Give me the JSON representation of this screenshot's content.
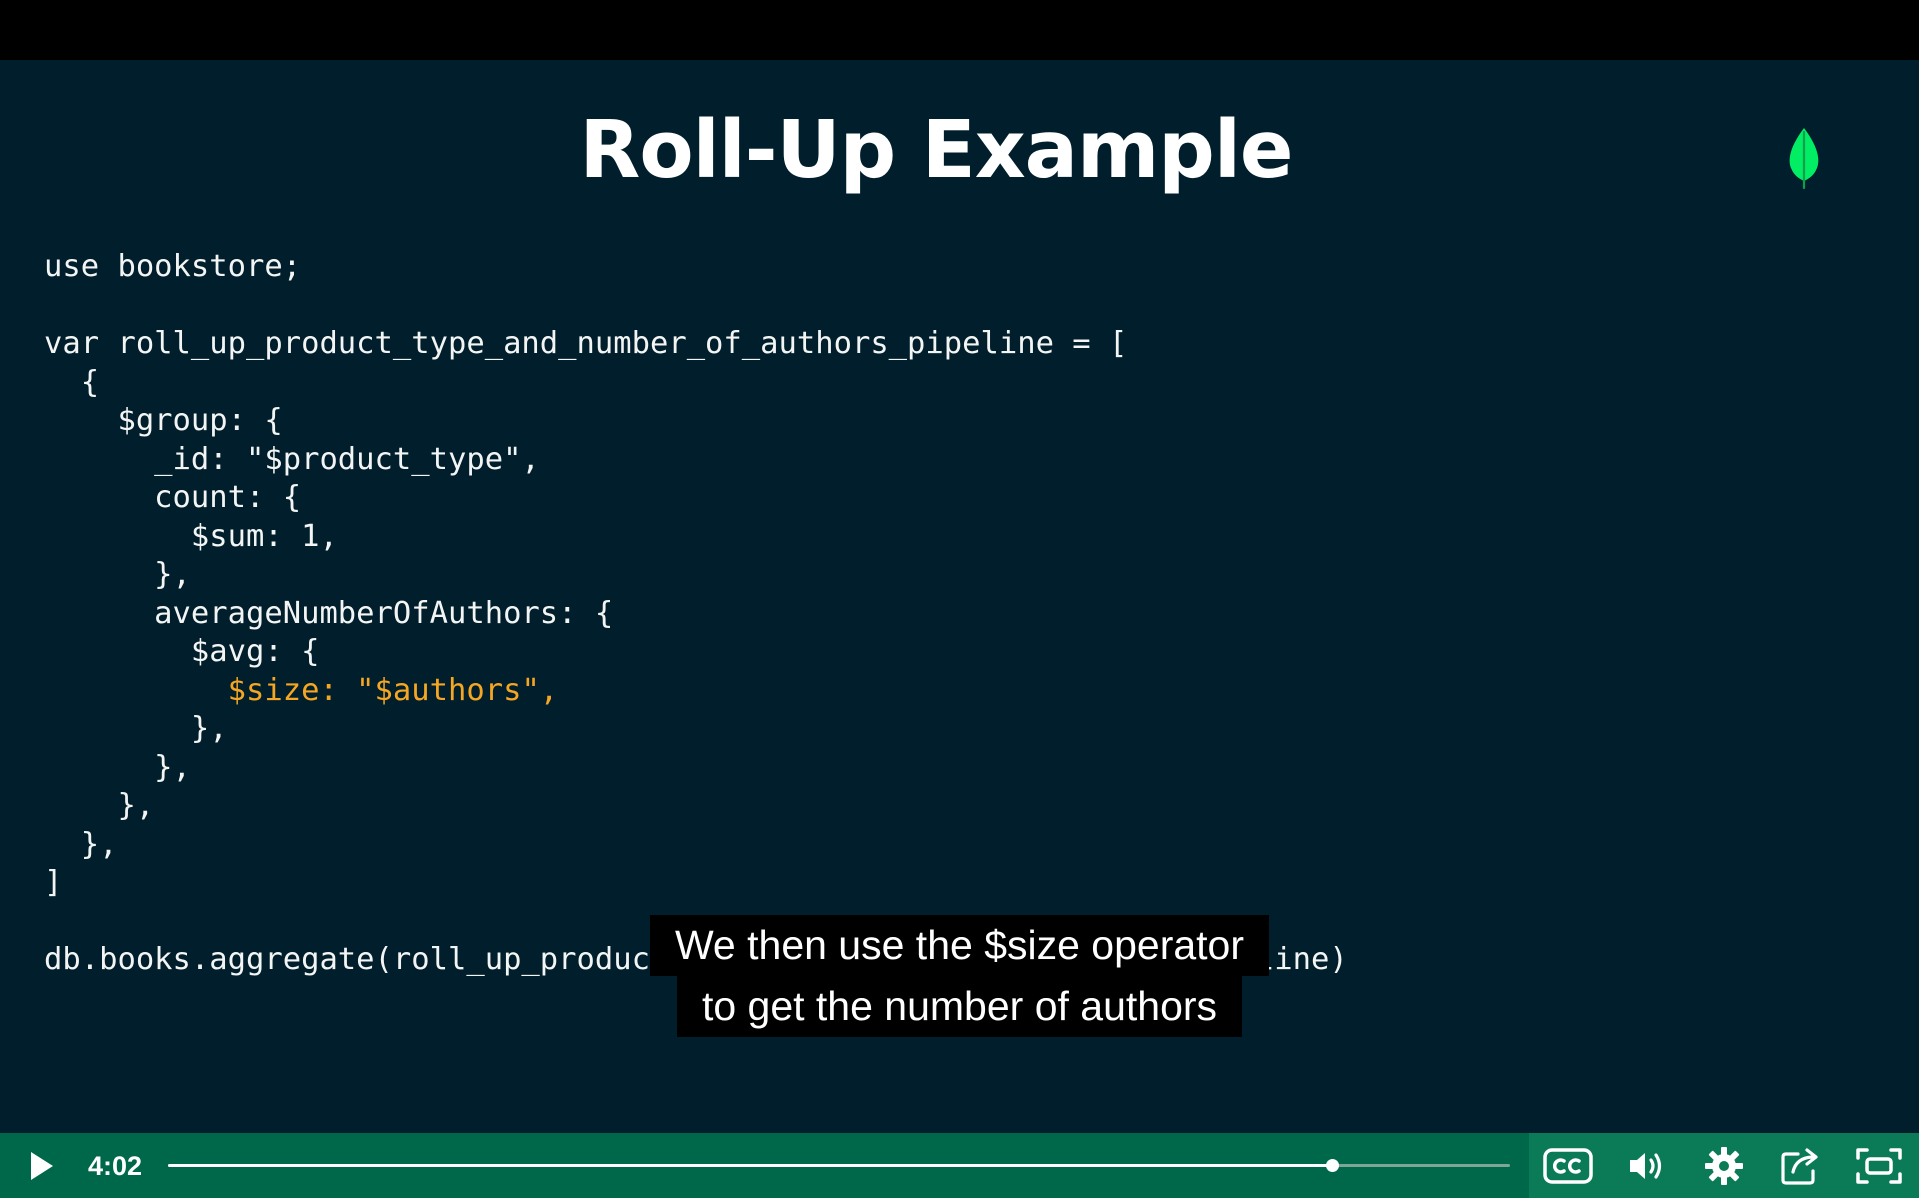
{
  "slide": {
    "title": "Roll-Up Example",
    "code_lines": [
      "use bookstore;",
      "",
      "var roll_up_product_type_and_number_of_authors_pipeline = [",
      "  {",
      "    $group: {",
      "      _id: \"$product_type\",",
      "      count: {",
      "        $sum: 1,",
      "      },",
      "      averageNumberOfAuthors: {",
      "        $avg: {",
      "          $size: \"$authors\",",
      "        },",
      "      },",
      "    },",
      "  },",
      "]",
      "",
      "db.books.aggregate(roll_up_product_type_and_number_of_authors_pipeline)"
    ],
    "highlighted_line_index": 11,
    "colors": {
      "background": "#001e2b",
      "code_text": "#f3f5f4",
      "highlight": "#f5a623",
      "leaf": "#00ed64"
    },
    "logo_icon": "leaf-icon"
  },
  "captions": {
    "line1": "We then use the $size operator",
    "line2": "to get the number of authors"
  },
  "player": {
    "time": "4:02",
    "progress_fraction": 0.867,
    "accent_color": "#00684a",
    "icons": [
      "play-icon",
      "closed-captions-icon",
      "volume-icon",
      "gear-icon",
      "share-icon",
      "fullscreen-icon"
    ]
  }
}
